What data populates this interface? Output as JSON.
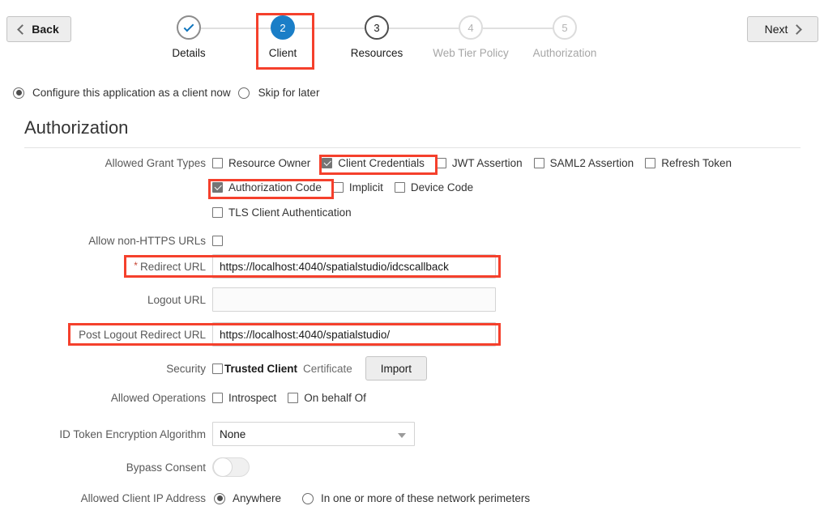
{
  "nav": {
    "back_label": "Back",
    "next_label": "Next",
    "back_icon": "chevron-left-icon",
    "next_icon": "chevron-right-icon"
  },
  "stepper": {
    "steps": [
      {
        "number": "1",
        "label": "Details",
        "state": "done",
        "icon": "check-icon"
      },
      {
        "number": "2",
        "label": "Client",
        "state": "active",
        "highlighted": true
      },
      {
        "number": "3",
        "label": "Resources",
        "state": "current"
      },
      {
        "number": "4",
        "label": "Web Tier Policy",
        "state": "future"
      },
      {
        "number": "5",
        "label": "Authorization",
        "state": "future"
      }
    ]
  },
  "mode": {
    "option_configure": "Configure this application as a client now",
    "option_skip": "Skip for later",
    "selected": "configure"
  },
  "section": {
    "title": "Authorization"
  },
  "form": {
    "grant_types": {
      "label": "Allowed Grant Types",
      "row1": [
        {
          "label": "Resource Owner",
          "checked": false
        },
        {
          "label": "Client Credentials",
          "checked": true,
          "highlighted": true
        },
        {
          "label": "JWT Assertion",
          "checked": false
        },
        {
          "label": "SAML2 Assertion",
          "checked": false
        },
        {
          "label": "Refresh Token",
          "checked": false
        }
      ],
      "row2": [
        {
          "label": "Authorization Code",
          "checked": true,
          "highlighted": true
        },
        {
          "label": "Implicit",
          "checked": false
        },
        {
          "label": "Device Code",
          "checked": false
        }
      ],
      "row3": [
        {
          "label": "TLS Client Authentication",
          "checked": false
        }
      ]
    },
    "allow_non_https": {
      "label": "Allow non-HTTPS URLs",
      "checked": false
    },
    "redirect_url": {
      "label": "Redirect URL",
      "required": true,
      "required_marker": "*",
      "value": "https://localhost:4040/spatialstudio/idcscallback",
      "highlighted": true
    },
    "logout_url": {
      "label": "Logout URL",
      "value": ""
    },
    "post_logout_redirect_url": {
      "label": "Post Logout Redirect URL",
      "value": "https://localhost:4040/spatialstudio/",
      "highlighted": true
    },
    "security": {
      "label": "Security",
      "trusted_client_label": "Trusted Client",
      "trusted_client_checked": false,
      "certificate_label": "Certificate",
      "import_label": "Import"
    },
    "allowed_operations": {
      "label": "Allowed Operations",
      "items": [
        {
          "label": "Introspect",
          "checked": false
        },
        {
          "label": "On behalf Of",
          "checked": false
        }
      ]
    },
    "id_token_encryption": {
      "label": "ID Token Encryption Algorithm",
      "value": "None",
      "caret_icon": "chevron-down-icon"
    },
    "bypass_consent": {
      "label": "Bypass Consent",
      "enabled": false
    },
    "allowed_client_ip": {
      "label": "Allowed Client IP Address",
      "option_anywhere": "Anywhere",
      "option_perimeters": "In one or more of these network perimeters",
      "selected": "anywhere"
    }
  },
  "colors": {
    "accent_blue": "#1a7ec7",
    "highlight_red": "#f5402c",
    "checkbox_fill": "#757575",
    "label_gray": "#595959"
  }
}
